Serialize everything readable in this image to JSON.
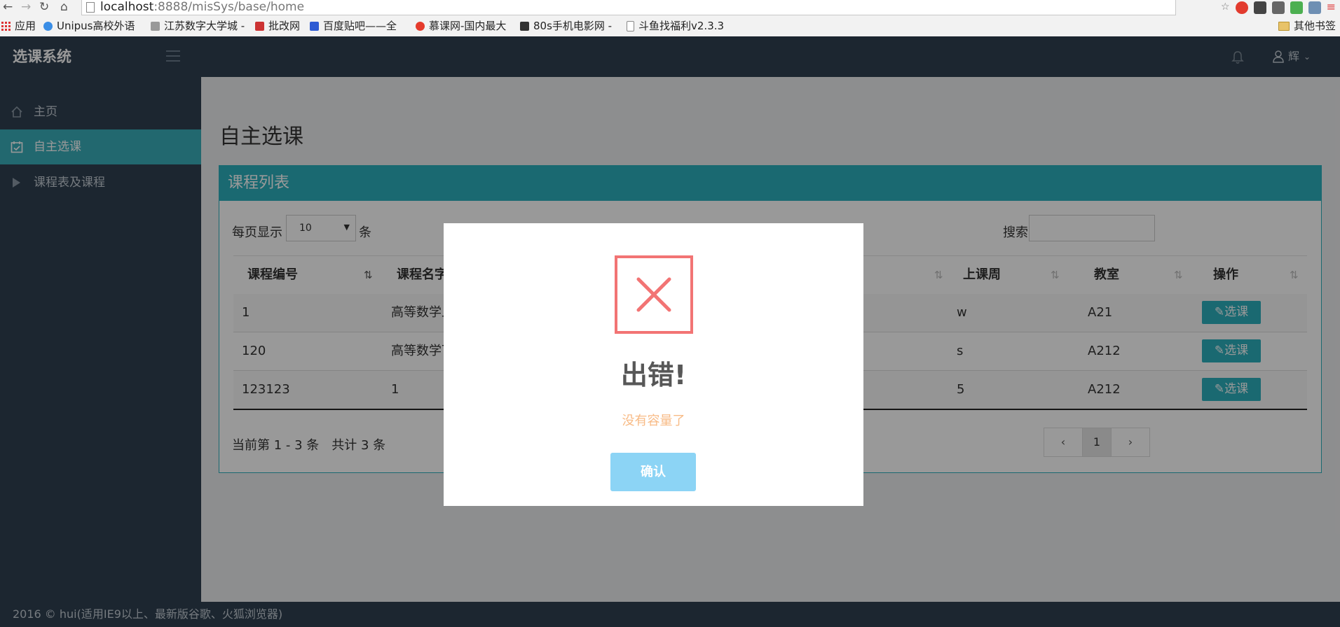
{
  "browser": {
    "url_host": "localhost",
    "url_path": ":8888/misSys/base/home",
    "bookmarks": [
      {
        "label": "应用",
        "icon": "apps-icon"
      },
      {
        "label": "Unipus高校外语",
        "icon": "unipus-icon"
      },
      {
        "label": "江苏数字大学城 -",
        "icon": "jiangsu-icon"
      },
      {
        "label": "批改网",
        "icon": "pigai-icon"
      },
      {
        "label": "百度贴吧——全",
        "icon": "tieba-icon"
      },
      {
        "label": "慕课网-国内最大",
        "icon": "imooc-icon"
      },
      {
        "label": "80s手机电影网 -",
        "icon": "film-icon"
      },
      {
        "label": "斗鱼找福利v2.3.3",
        "icon": "page-icon"
      }
    ],
    "other_bookmarks": "其他书签"
  },
  "header": {
    "brand": "选课系统",
    "user": "辉"
  },
  "sidebar": {
    "items": [
      {
        "label": "主页",
        "icon": "home-icon",
        "active": false
      },
      {
        "label": "自主选课",
        "icon": "calendar-check-icon",
        "active": true
      },
      {
        "label": "课程表及课程",
        "icon": "caret-right-icon",
        "active": false
      }
    ]
  },
  "main": {
    "page_title": "自主选课",
    "panel_title": "课程列表",
    "length_label": "每页显示",
    "length_value": "10",
    "length_unit": "条",
    "search_label": "搜索",
    "columns": [
      "课程编号",
      "课程名字",
      "上课周",
      "教室",
      "操作"
    ],
    "rows": [
      {
        "id": "1",
        "name": "高等数学上",
        "week": "w",
        "room": "A21",
        "action": "选课"
      },
      {
        "id": "120",
        "name": "高等数学下",
        "week": "s",
        "room": "A212",
        "action": "选课"
      },
      {
        "id": "123123",
        "name": "1",
        "week": "5",
        "room": "A212",
        "action": "选课"
      }
    ],
    "info": "当前第 1 - 3 条　共计 3 条",
    "pager": {
      "prev": "‹",
      "current": "1",
      "next": "›"
    }
  },
  "footer": "2016 © hui(适用IE9以上、最新版谷歌、火狐浏览器)",
  "dialog": {
    "title": "出错!",
    "text": "没有容量了",
    "confirm": "确认",
    "icon": "error-x-icon",
    "colors": {
      "error": "#f27474",
      "text": "#f8bb86",
      "button": "#8cd4f5"
    }
  },
  "theme": {
    "sidebar": "#2f4050",
    "accent": "#2cb0bd"
  }
}
